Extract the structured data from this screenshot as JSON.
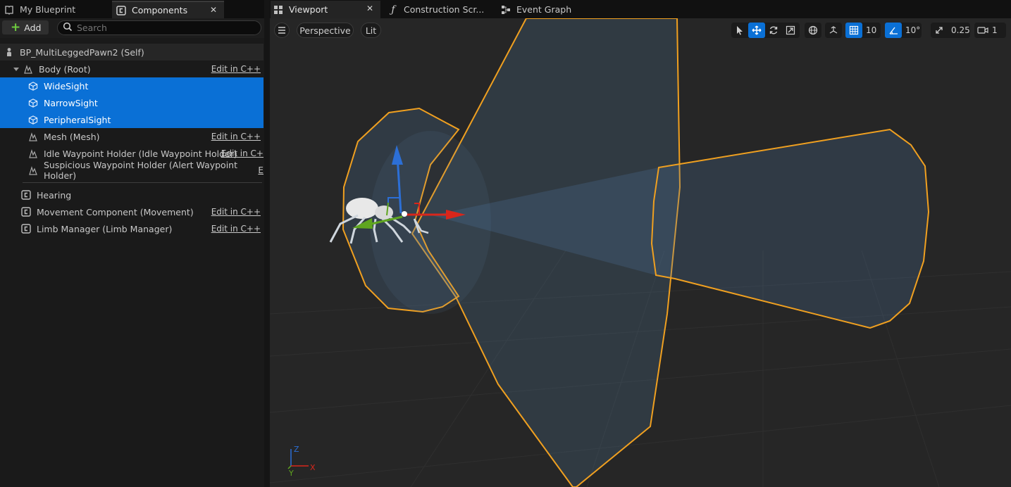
{
  "left_tabs": {
    "blueprint_label": "My Blueprint",
    "components_label": "Components"
  },
  "toolbar": {
    "add_label": "Add",
    "search_placeholder": "Search"
  },
  "tree": {
    "self": "BP_MultiLeggedPawn2 (Self)",
    "body": "Body (Root)",
    "wide": "WideSight",
    "narrow": "NarrowSight",
    "peripheral": "PeripheralSight",
    "mesh": "Mesh (Mesh)",
    "idle": "Idle Waypoint Holder (Idle Waypoint Holder)",
    "suspicious": "Suspicious Waypoint Holder (Alert Waypoint Holder)",
    "hearing": "Hearing",
    "movement": "Movement Component (Movement)",
    "limb": "Limb Manager (Limb Manager)",
    "edit_cpp": "Edit in C++",
    "edit_cpp_trunc1": "Edit in C+",
    "edit_cpp_trunc2": "E"
  },
  "viewport_tabs": {
    "viewport": "Viewport",
    "construction": "Construction Scr...",
    "event_graph": "Event Graph"
  },
  "viewport_toolbar": {
    "perspective": "Perspective",
    "lit": "Lit",
    "grid_snap": "10",
    "rot_snap": "10°",
    "scale_snap": "0.25",
    "camera_speed": "1"
  },
  "axis": {
    "x": "X",
    "y": "Y",
    "z": "Z"
  },
  "colors": {
    "selection": "#0a70d6",
    "outline": "#f5a623",
    "x_axis": "#d8261b",
    "y_axis": "#5fa51f",
    "z_axis": "#2c6fd6"
  }
}
